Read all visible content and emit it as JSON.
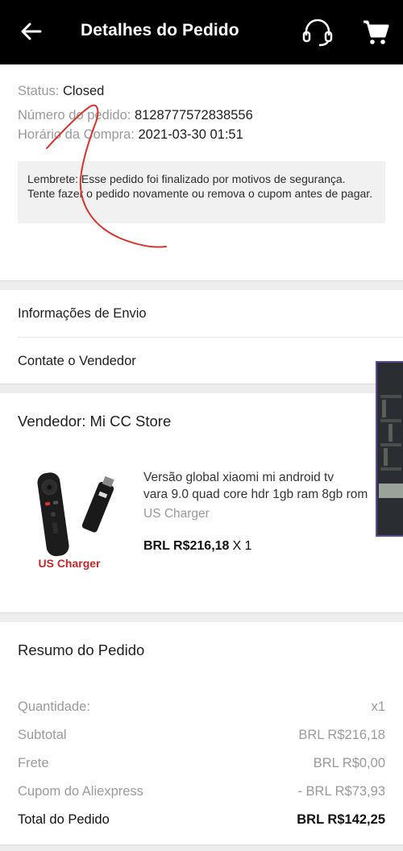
{
  "header": {
    "title": "Detalhes do Pedido",
    "back_icon": "back-arrow-icon",
    "support_icon": "headset-icon",
    "cart_icon": "cart-icon"
  },
  "status": {
    "status_label": "Status:",
    "status_value": "Closed",
    "order_number_label": "Número do pedido:",
    "order_number_value": "8128777572838556",
    "purchase_time_label": "Horário da Compra:",
    "purchase_time_value": "2021-03-30 01:51",
    "notice": "Lembrete: Esse pedido foi finalizado por motivos de segurança. Tente fazer o pedido novamente ou remova o cupom antes de pagar."
  },
  "links": {
    "shipping_info": "Informações de Envio",
    "contact_seller": "Contate o Vendedor"
  },
  "seller": {
    "title": "Vendedor: Mi CC Store",
    "product": {
      "name_line1": "Versão global xiaomi mi android tv",
      "name_line2": "vara 9.0 quad core hdr 1gb ram 8gb rom",
      "variant": "US Charger",
      "price": "BRL R$216,18",
      "quantity": "X 1",
      "image_caption": "US Charger"
    }
  },
  "summary": {
    "title": "Resumo do Pedido",
    "rows": [
      {
        "label": "Quantidade:",
        "value": "x1"
      },
      {
        "label": "Subtotal",
        "value": "BRL R$216,18"
      },
      {
        "label": "Frete",
        "value": "BRL R$0,00"
      },
      {
        "label": "Cupom do Aliexpress",
        "value": "- BRL R$73,93"
      }
    ],
    "total_label": "Total do Pedido",
    "total_value": "BRL R$142,25"
  },
  "colors": {
    "header_bg": "#000000",
    "scribble": "#d9342b",
    "muted_text": "#9a9a9a",
    "section_gap": "#ededed"
  }
}
